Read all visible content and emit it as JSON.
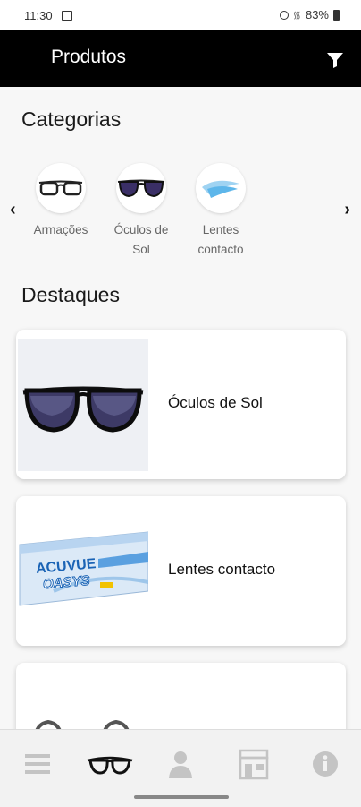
{
  "status_bar": {
    "time": "11:30",
    "battery": "83%"
  },
  "header": {
    "title": "Produtos",
    "filter_icon": "filter-icon"
  },
  "categories": {
    "title": "Categorias",
    "items": [
      {
        "line1": "Armações",
        "line2": "",
        "icon": "eyeglasses-icon"
      },
      {
        "line1": "Óculos de",
        "line2": "Sol",
        "icon": "sunglasses-icon"
      },
      {
        "line1": "Lentes",
        "line2": "contacto",
        "icon": "contact-lens-icon"
      }
    ],
    "prev_icon": "chevron-left-icon",
    "next_icon": "chevron-right-icon"
  },
  "highlights": {
    "title": "Destaques",
    "items": [
      {
        "label": "Óculos de Sol",
        "image": "sunglasses-image"
      },
      {
        "label": "Lentes contacto",
        "image": "acuvue-oasys-box-image",
        "box_brand": "ACUVUE",
        "box_product": "OASYS"
      },
      {
        "label": "",
        "image": "eyeglasses-image"
      }
    ]
  },
  "bottom_nav": {
    "items": [
      {
        "icon": "menu-icon",
        "active": false
      },
      {
        "icon": "glasses-icon",
        "active": true
      },
      {
        "icon": "person-icon",
        "active": false
      },
      {
        "icon": "store-icon",
        "active": false
      },
      {
        "icon": "info-icon",
        "active": false
      }
    ]
  },
  "colors": {
    "app_bar": "#000000",
    "background": "#f7f7f7",
    "inactive_icon": "#c4c4c4",
    "active_icon": "#111111"
  }
}
